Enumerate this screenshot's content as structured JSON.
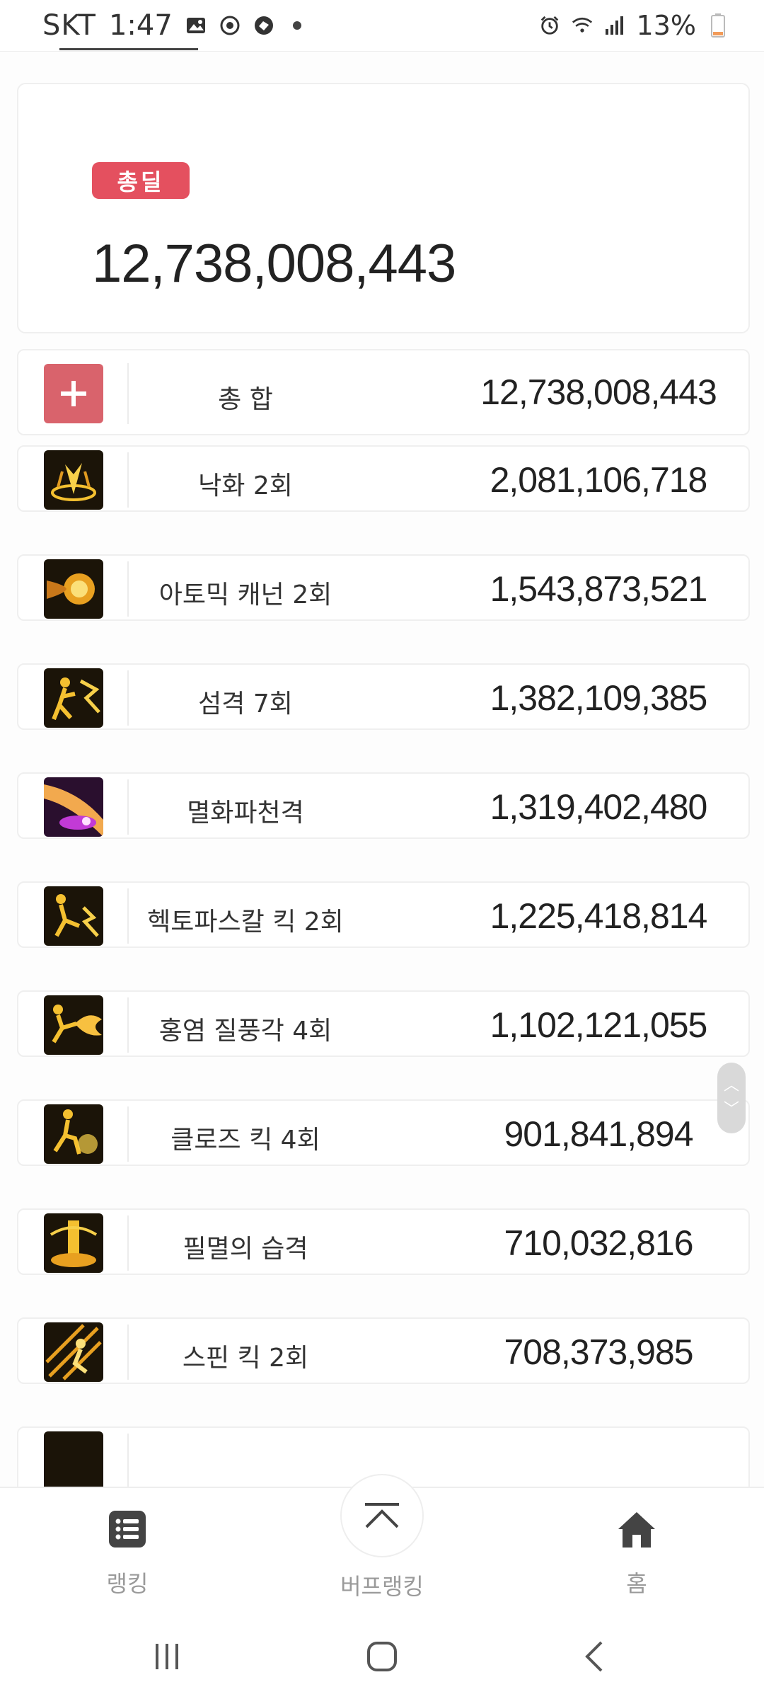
{
  "status_bar": {
    "carrier": "SKT",
    "time": "1:47",
    "battery": "13%"
  },
  "summary": {
    "badge_label": "총딜",
    "total_value": "12,738,008,443"
  },
  "rows": [
    {
      "name": "총 합",
      "value": "12,738,008,443",
      "icon": "plus-icon"
    },
    {
      "name": "낙화 2회",
      "value": "2,081,106,718",
      "icon": "falling-flower-skill-icon"
    },
    {
      "name": "아토믹 캐넌 2회",
      "value": "1,543,873,521",
      "icon": "atomic-cannon-skill-icon"
    },
    {
      "name": "섬격 7회",
      "value": "1,382,109,385",
      "icon": "flash-strike-skill-icon"
    },
    {
      "name": "멸화파천격",
      "value": "1,319,402,480",
      "icon": "annihilation-strike-skill-icon"
    },
    {
      "name": "헥토파스칼 킥 2회",
      "value": "1,225,418,814",
      "icon": "hectopascal-kick-skill-icon"
    },
    {
      "name": "홍염 질풍각 4회",
      "value": "1,102,121,055",
      "icon": "crimson-gale-kick-skill-icon"
    },
    {
      "name": "클로즈 킥 4회",
      "value": "901,841,894",
      "icon": "close-kick-skill-icon"
    },
    {
      "name": "필멸의 습격",
      "value": "710,032,816",
      "icon": "mortal-assault-skill-icon"
    },
    {
      "name": "스핀 킥 2회",
      "value": "708,373,985",
      "icon": "spin-kick-skill-icon"
    }
  ],
  "bottom_nav": {
    "ranking_label": "랭킹",
    "buff_ranking_label": "버프랭킹",
    "home_label": "홈"
  },
  "colors": {
    "badge": "#e4505f",
    "plus_box": "#d9636c"
  }
}
